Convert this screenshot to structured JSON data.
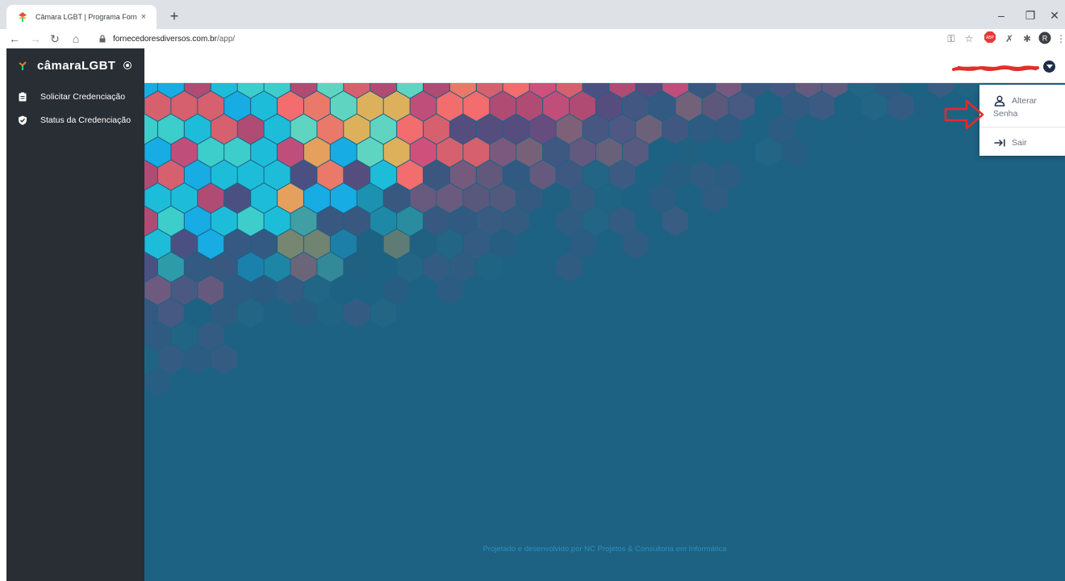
{
  "browser": {
    "tab_title": "Câmara LGBT | Programa Fornec",
    "tab_close": "×",
    "new_tab": "+",
    "url_host": "fornecedoresdiversos.com.br",
    "url_path": "/app/",
    "window_controls": [
      "–",
      "❐",
      "✕"
    ],
    "extensions": [
      "key-icon",
      "star-icon",
      "adblock-icon",
      "pin-icon",
      "puzzle-icon",
      "profile-avatar",
      "menu-icon"
    ],
    "profile_initial": "R",
    "adblock_label": "ABP"
  },
  "sidebar": {
    "brand_name": "câmaraLGBT",
    "items": [
      {
        "label": "Solicitar Credenciação",
        "icon": "clipboard-icon"
      },
      {
        "label": "Status da Credenciação",
        "icon": "shield-check-icon"
      }
    ]
  },
  "topbar": {
    "user_email": "redacted"
  },
  "dropdown": {
    "change_password_line1": "Alterar",
    "change_password_line2": "Senha",
    "logout": "Sair"
  },
  "footer": {
    "text": "Projetado e desenvolvido por NC Projetos & Consultoria em Informática"
  },
  "colors": {
    "sidebar": "#292e35",
    "content_bg": "#1d6282",
    "accent_arrow": "#e32b2b",
    "footer_text": "#2a8fc4"
  }
}
